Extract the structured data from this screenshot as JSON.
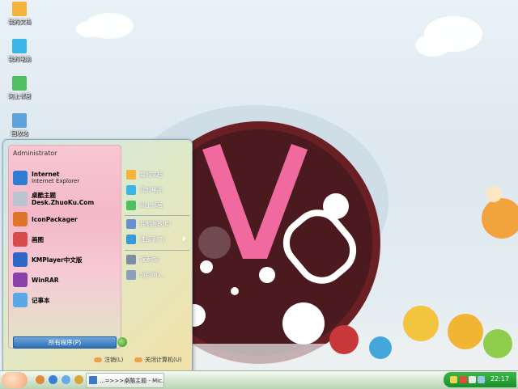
{
  "desktop": {
    "icons": [
      {
        "label": "我的文档",
        "icon": "my-documents-icon",
        "color": "#f3b33d"
      },
      {
        "label": "我的电脑",
        "icon": "my-computer-icon",
        "color": "#3bb5e8"
      },
      {
        "label": "网上邻居",
        "icon": "network-places-icon",
        "color": "#4fbf62"
      },
      {
        "label": "回收站",
        "icon": "recycle-bin-icon",
        "color": "#5fa2e0"
      }
    ]
  },
  "start_menu": {
    "user": "Administrator",
    "left_items": [
      {
        "label": "Internet",
        "sub": "Internet Explorer",
        "icon": "internet-explorer-icon",
        "color": "#2f7bd6"
      },
      {
        "label": "桌酷主题Desk.ZhuoKu.Com",
        "sub": "",
        "icon": "zhuoku-theme-icon",
        "color": "#b9c4cf"
      },
      {
        "label": "IconPackager",
        "sub": "",
        "icon": "iconpackager-icon",
        "color": "#e0742a"
      },
      {
        "label": "画图",
        "sub": "",
        "icon": "paint-icon",
        "color": "#d84b4b"
      },
      {
        "label": "KMPlayer中文版",
        "sub": "",
        "icon": "kmplayer-icon",
        "color": "#2f66c7"
      },
      {
        "label": "WinRAR",
        "sub": "",
        "icon": "winrar-icon",
        "color": "#8b3fa8"
      },
      {
        "label": "记事本",
        "sub": "",
        "icon": "notepad-icon",
        "color": "#5aa7e3"
      }
    ],
    "all_programs": "所有程序(P)",
    "right_items": [
      {
        "label": "我的文档",
        "icon": "my-documents-icon",
        "color": "#f3b33d"
      },
      {
        "label": "我的电脑",
        "icon": "my-computer-icon",
        "color": "#3bb5e8"
      },
      {
        "label": "网上邻居",
        "icon": "network-places-icon",
        "color": "#4fbf62"
      },
      {
        "label": "控制面板(C)",
        "icon": "control-panel-icon",
        "color": "#6a8fd0"
      },
      {
        "label": "连接到(T)",
        "icon": "connect-to-icon",
        "color": "#3a9ad9"
      },
      {
        "label": "搜索(S)",
        "icon": "search-icon",
        "color": "#7b8ea6"
      },
      {
        "label": "运行(R)...",
        "icon": "run-icon",
        "color": "#8aa0b8"
      }
    ],
    "logoff": "注销(L)",
    "shutdown": "关闭计算机(U)"
  },
  "taskbar": {
    "task_label": "...=>>>桌酷主题 - Mic...",
    "clock": "22:17"
  }
}
